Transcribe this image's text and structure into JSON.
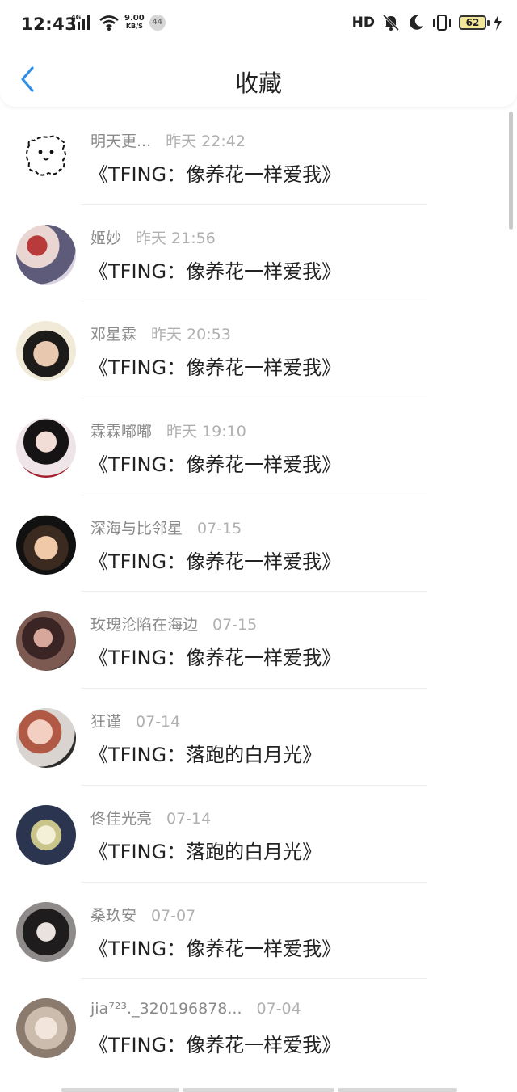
{
  "status_bar": {
    "time": "12:43",
    "network": "4G",
    "speed_value": "9.00",
    "speed_unit": "KB/S",
    "badge": "44",
    "hd": "HD",
    "battery": "62"
  },
  "navbar": {
    "title": "收藏"
  },
  "items": [
    {
      "name": "明天更...",
      "time": "昨天 22:42",
      "title": "《TFING：像养花一样爱我》"
    },
    {
      "name": "姬妙",
      "time": "昨天 21:56",
      "title": "《TFING：像养花一样爱我》"
    },
    {
      "name": "邓星霖",
      "time": "昨天 20:53",
      "title": "《TFING：像养花一样爱我》"
    },
    {
      "name": "霖霖嘟嘟",
      "time": "昨天 19:10",
      "title": "《TFING：像养花一样爱我》"
    },
    {
      "name": "深海与比邻星",
      "time": "07-15",
      "title": "《TFING：像养花一样爱我》"
    },
    {
      "name": "玫瑰沦陷在海边",
      "time": "07-15",
      "title": "《TFING：像养花一样爱我》"
    },
    {
      "name": "狂谨",
      "time": "07-14",
      "title": "《TFING：落跑的白月光》"
    },
    {
      "name": "佟佳光亮",
      "time": "07-14",
      "title": "《TFING：落跑的白月光》"
    },
    {
      "name": "桑玖安",
      "time": "07-07",
      "title": "《TFING：像养花一样爱我》"
    },
    {
      "name": "jia⁷²³._320196878...",
      "time": "07-04",
      "title": "《TFING：像养花一样爱我》"
    }
  ],
  "colors": {
    "accent": "#2f8fe8",
    "meta_text": "#8a8a8a",
    "title_text": "#222222"
  }
}
